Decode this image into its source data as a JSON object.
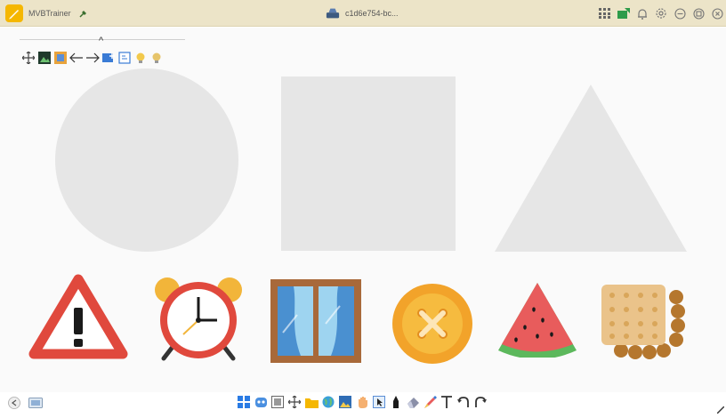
{
  "titlebar": {
    "app_name": "MVBTrainer",
    "document_name": "c1d6e754-bc...",
    "accent": "#f5b700"
  },
  "floating_toolbar": {
    "tools": [
      "move-icon",
      "image-icon",
      "layers-icon",
      "arrow-left-icon",
      "arrow-right-icon",
      "insert-icon",
      "frame-icon",
      "bulb-on-icon",
      "bulb-off-icon"
    ]
  },
  "shapes": {
    "placeholders": [
      "circle",
      "square",
      "triangle"
    ],
    "placeholder_color": "#e6e6e6",
    "cards": [
      "warning-sign-icon",
      "alarm-clock-icon",
      "window-icon",
      "button-icon",
      "watermelon-slice-icon",
      "biscuit-icon"
    ]
  },
  "bottom_toolbar": {
    "tools": [
      "grid-icon",
      "robot-icon",
      "media-icon",
      "move-icon",
      "folder-icon",
      "globe-icon",
      "photo-icon",
      "hand-icon",
      "pointer-icon",
      "pen-icon",
      "eraser-icon",
      "color-pen-icon",
      "text-icon",
      "undo-icon",
      "redo-icon"
    ]
  }
}
